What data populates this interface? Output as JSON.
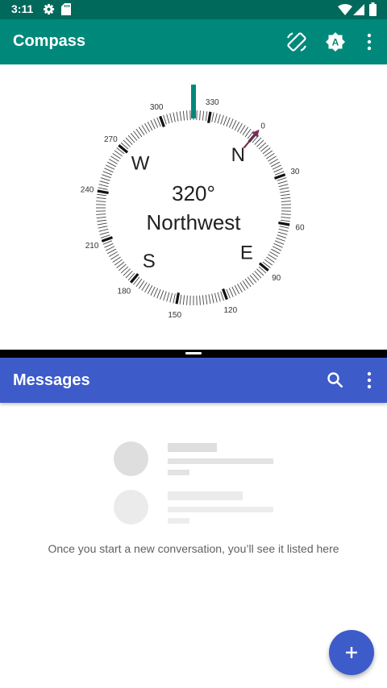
{
  "status_bar": {
    "time": "3:11"
  },
  "compass_app": {
    "title": "Compass",
    "degrees_text": "320°",
    "direction_text": "Northwest",
    "heading_deg": 320,
    "cardinals": [
      "N",
      "E",
      "S",
      "W"
    ],
    "tick_labels": [
      "0",
      "30",
      "60",
      "90",
      "120",
      "150",
      "180",
      "210",
      "240",
      "270",
      "300",
      "330"
    ],
    "accent_color": "#00897b",
    "needle_color": "#7b2d5a"
  },
  "messages_app": {
    "title": "Messages",
    "empty_text": "Once you start a new conversation, you’ll see it listed here",
    "accent_color": "#3d5bc9"
  }
}
